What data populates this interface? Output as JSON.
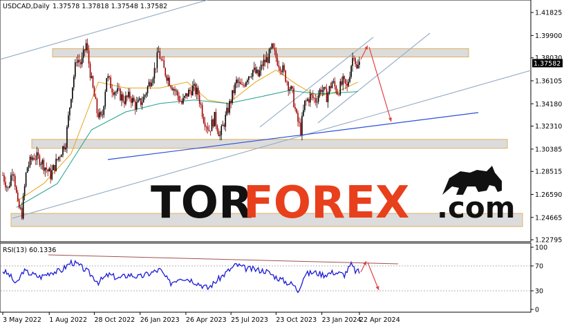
{
  "chart_data": {
    "type": "candlestick",
    "symbol_label": "USDCAD,Daily",
    "ohlc_label": "1.37578 1.37818 1.37548 1.37582",
    "last_price": "1.37582",
    "price_axis": {
      "ticks": [
        "1.41825",
        "1.39900",
        "1.38030",
        "1.36105",
        "1.34180",
        "1.32310",
        "1.30385",
        "1.28515",
        "1.26590",
        "1.24665",
        "1.22795"
      ],
      "ylim": [
        1.228,
        1.4183
      ]
    },
    "x_axis": {
      "ticks": [
        "3 May 2022",
        "1 Aug 2022",
        "28 Oct 2022",
        "26 Jan 2023",
        "26 Apr 2023",
        "25 Jul 2023",
        "23 Oct 2023",
        "23 Jan 2024",
        "22 Apr 2024"
      ]
    },
    "price_path": [
      {
        "t": 0,
        "v": 1.282
      },
      {
        "t": 8,
        "v": 1.27
      },
      {
        "t": 15,
        "v": 1.29
      },
      {
        "t": 22,
        "v": 1.256
      },
      {
        "t": 28,
        "v": 1.25
      },
      {
        "t": 35,
        "v": 1.288
      },
      {
        "t": 45,
        "v": 1.298
      },
      {
        "t": 55,
        "v": 1.295
      },
      {
        "t": 63,
        "v": 1.288
      },
      {
        "t": 70,
        "v": 1.282
      },
      {
        "t": 80,
        "v": 1.295
      },
      {
        "t": 92,
        "v": 1.31
      },
      {
        "t": 100,
        "v": 1.35
      },
      {
        "t": 108,
        "v": 1.38
      },
      {
        "t": 115,
        "v": 1.375
      },
      {
        "t": 122,
        "v": 1.392
      },
      {
        "t": 130,
        "v": 1.36
      },
      {
        "t": 138,
        "v": 1.335
      },
      {
        "t": 145,
        "v": 1.328
      },
      {
        "t": 152,
        "v": 1.365
      },
      {
        "t": 160,
        "v": 1.355
      },
      {
        "t": 170,
        "v": 1.35
      },
      {
        "t": 178,
        "v": 1.345
      },
      {
        "t": 186,
        "v": 1.348
      },
      {
        "t": 195,
        "v": 1.34
      },
      {
        "t": 205,
        "v": 1.345
      },
      {
        "t": 215,
        "v": 1.36
      },
      {
        "t": 222,
        "v": 1.37
      },
      {
        "t": 228,
        "v": 1.385
      },
      {
        "t": 236,
        "v": 1.37
      },
      {
        "t": 245,
        "v": 1.36
      },
      {
        "t": 255,
        "v": 1.35
      },
      {
        "t": 262,
        "v": 1.342
      },
      {
        "t": 270,
        "v": 1.35
      },
      {
        "t": 278,
        "v": 1.355
      },
      {
        "t": 286,
        "v": 1.35
      },
      {
        "t": 294,
        "v": 1.33
      },
      {
        "t": 302,
        "v": 1.32
      },
      {
        "t": 310,
        "v": 1.33
      },
      {
        "t": 318,
        "v": 1.315
      },
      {
        "t": 326,
        "v": 1.33
      },
      {
        "t": 334,
        "v": 1.345
      },
      {
        "t": 342,
        "v": 1.36
      },
      {
        "t": 350,
        "v": 1.355
      },
      {
        "t": 358,
        "v": 1.365
      },
      {
        "t": 366,
        "v": 1.37
      },
      {
        "t": 374,
        "v": 1.365
      },
      {
        "t": 380,
        "v": 1.375
      },
      {
        "t": 388,
        "v": 1.38
      },
      {
        "t": 394,
        "v": 1.388
      },
      {
        "t": 402,
        "v": 1.378
      },
      {
        "t": 410,
        "v": 1.37
      },
      {
        "t": 418,
        "v": 1.358
      },
      {
        "t": 424,
        "v": 1.35
      },
      {
        "t": 430,
        "v": 1.33
      },
      {
        "t": 436,
        "v": 1.32
      },
      {
        "t": 442,
        "v": 1.342
      },
      {
        "t": 450,
        "v": 1.348
      },
      {
        "t": 458,
        "v": 1.345
      },
      {
        "t": 466,
        "v": 1.355
      },
      {
        "t": 474,
        "v": 1.348
      },
      {
        "t": 482,
        "v": 1.36
      },
      {
        "t": 490,
        "v": 1.352
      },
      {
        "t": 498,
        "v": 1.36
      },
      {
        "t": 504,
        "v": 1.355
      },
      {
        "t": 510,
        "v": 1.375
      },
      {
        "t": 514,
        "v": 1.385
      },
      {
        "t": 518,
        "v": 1.37
      },
      {
        "t": 522,
        "v": 1.3758
      }
    ],
    "moving_averages": [
      {
        "color": "#e8a317",
        "points": [
          {
            "t": 20,
            "v": 1.26
          },
          {
            "t": 60,
            "v": 1.275
          },
          {
            "t": 100,
            "v": 1.3
          },
          {
            "t": 140,
            "v": 1.36
          },
          {
            "t": 180,
            "v": 1.355
          },
          {
            "t": 230,
            "v": 1.355
          },
          {
            "t": 270,
            "v": 1.36
          },
          {
            "t": 300,
            "v": 1.345
          },
          {
            "t": 330,
            "v": 1.342
          },
          {
            "t": 370,
            "v": 1.36
          },
          {
            "t": 400,
            "v": 1.37
          },
          {
            "t": 430,
            "v": 1.358
          },
          {
            "t": 460,
            "v": 1.348
          },
          {
            "t": 490,
            "v": 1.352
          },
          {
            "t": 520,
            "v": 1.36
          }
        ]
      },
      {
        "color": "#20a08a",
        "points": [
          {
            "t": 20,
            "v": 1.255
          },
          {
            "t": 80,
            "v": 1.275
          },
          {
            "t": 130,
            "v": 1.32
          },
          {
            "t": 180,
            "v": 1.335
          },
          {
            "t": 230,
            "v": 1.342
          },
          {
            "t": 280,
            "v": 1.345
          },
          {
            "t": 330,
            "v": 1.342
          },
          {
            "t": 380,
            "v": 1.348
          },
          {
            "t": 420,
            "v": 1.353
          },
          {
            "t": 460,
            "v": 1.35
          },
          {
            "t": 520,
            "v": 1.352
          }
        ]
      }
    ],
    "zones": [
      {
        "name": "resistance",
        "from": 1.381,
        "to": 1.388
      },
      {
        "name": "support-middle",
        "from": 1.3045,
        "to": 1.312
      },
      {
        "name": "support-lower",
        "from": 1.239,
        "to": 1.25
      }
    ],
    "rsi": {
      "label": "RSI(13) 60.1336",
      "ticks": [
        "100",
        "70",
        "30",
        "0"
      ],
      "ylim": [
        0,
        100
      ],
      "path": [
        {
          "t": 0,
          "v": 62
        },
        {
          "t": 10,
          "v": 55
        },
        {
          "t": 20,
          "v": 40
        },
        {
          "t": 30,
          "v": 62
        },
        {
          "t": 40,
          "v": 58
        },
        {
          "t": 55,
          "v": 52
        },
        {
          "t": 70,
          "v": 60
        },
        {
          "t": 85,
          "v": 62
        },
        {
          "t": 100,
          "v": 76
        },
        {
          "t": 110,
          "v": 72
        },
        {
          "t": 125,
          "v": 60
        },
        {
          "t": 140,
          "v": 44
        },
        {
          "t": 155,
          "v": 56
        },
        {
          "t": 170,
          "v": 50
        },
        {
          "t": 185,
          "v": 56
        },
        {
          "t": 200,
          "v": 52
        },
        {
          "t": 215,
          "v": 58
        },
        {
          "t": 230,
          "v": 64
        },
        {
          "t": 245,
          "v": 42
        },
        {
          "t": 260,
          "v": 52
        },
        {
          "t": 275,
          "v": 48
        },
        {
          "t": 290,
          "v": 40
        },
        {
          "t": 300,
          "v": 34
        },
        {
          "t": 315,
          "v": 48
        },
        {
          "t": 330,
          "v": 62
        },
        {
          "t": 342,
          "v": 72
        },
        {
          "t": 355,
          "v": 66
        },
        {
          "t": 370,
          "v": 64
        },
        {
          "t": 385,
          "v": 62
        },
        {
          "t": 400,
          "v": 52
        },
        {
          "t": 415,
          "v": 44
        },
        {
          "t": 425,
          "v": 40
        },
        {
          "t": 432,
          "v": 30
        },
        {
          "t": 442,
          "v": 56
        },
        {
          "t": 455,
          "v": 60
        },
        {
          "t": 470,
          "v": 56
        },
        {
          "t": 485,
          "v": 60
        },
        {
          "t": 500,
          "v": 56
        },
        {
          "t": 510,
          "v": 72
        },
        {
          "t": 516,
          "v": 62
        },
        {
          "t": 522,
          "v": 60
        }
      ]
    }
  },
  "watermark": {
    "tor": "TOR",
    "forex": "FOREX",
    "com": ".com"
  },
  "colors": {
    "bull": "#000000",
    "bear": "#a00000",
    "rsi": "#1a1ad6",
    "trend_blue": "#2a4fd6",
    "channel": "#9ab0c8",
    "arrow": "#e34040",
    "zone_fill": "#dcdcdc",
    "zone_edge": "#e0b060"
  }
}
